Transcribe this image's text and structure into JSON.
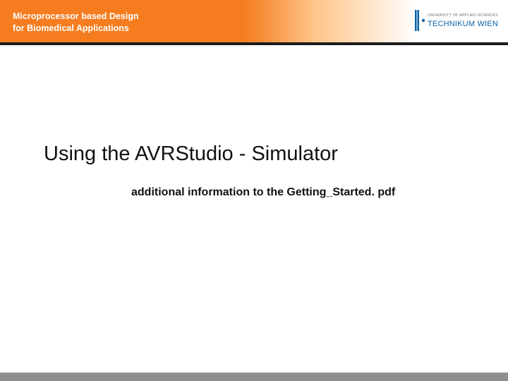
{
  "header": {
    "line1": "Microprocessor based Design",
    "line2": "for Biomedical Applications",
    "logo_top": "TECHNIKUM WIEN",
    "logo_sub": "UNIVERSITY OF APPLIED SCIENCES"
  },
  "main": {
    "title": "Using the AVRStudio - Simulator",
    "subtitle": "additional information to the Getting_Started. pdf"
  },
  "colors": {
    "accent": "#f57c1f",
    "divider": "#1b1b1b",
    "footer": "#8f8f8f",
    "logo_blue": "#0a63a6"
  }
}
